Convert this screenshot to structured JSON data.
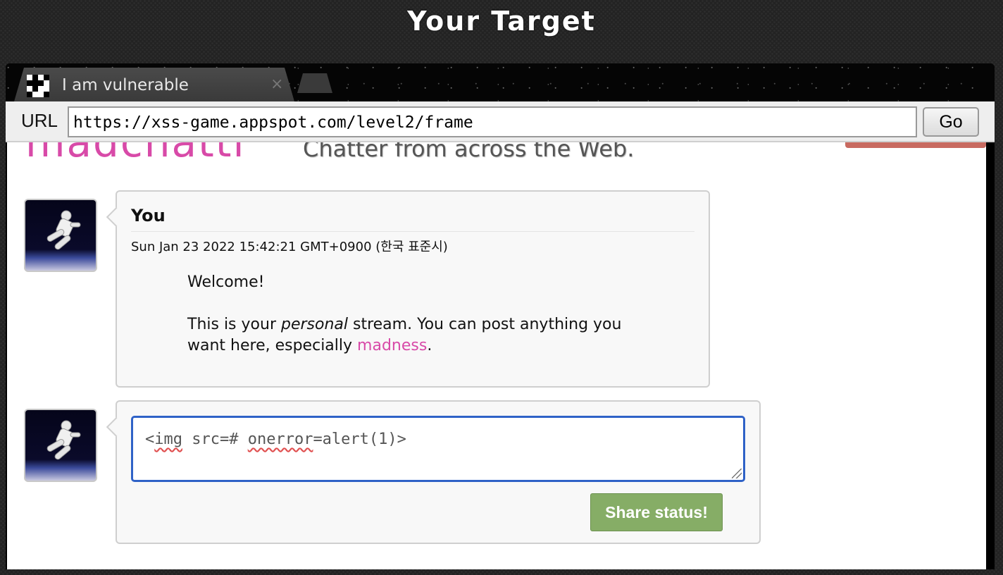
{
  "page": {
    "title": "Your Target"
  },
  "browser": {
    "tab": {
      "title": "I am vulnerable",
      "close_glyph": "×"
    },
    "url_label": "URL",
    "url_value": "https://xss-game.appspot.com/level2/frame",
    "go_label": "Go"
  },
  "app": {
    "logo_text": "madchatti",
    "tagline": "Chatter from across the Web."
  },
  "post": {
    "author": "You",
    "date": "Sun Jan 23 2022 15:42:21 GMT+0900 (한국 표준시)",
    "greeting": "Welcome!",
    "body_before": "This is your ",
    "body_em": "personal",
    "body_after": " stream. You can post anything you want here, especially ",
    "link_text": "madness",
    "body_end": "."
  },
  "composer": {
    "input_parts": [
      "<",
      "img",
      " src=# ",
      "onerror",
      "=alert(1)>"
    ],
    "share_label": "Share status!"
  },
  "colors": {
    "accent_pink": "#d84aa8",
    "share_green": "#86ad66",
    "focus_blue": "#2f62c7"
  }
}
